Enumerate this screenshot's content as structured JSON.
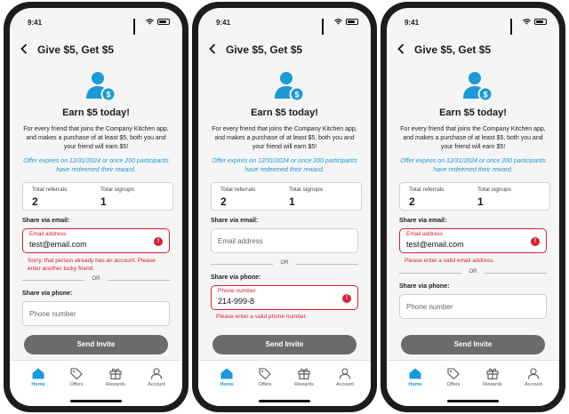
{
  "colors": {
    "accent": "#1a9ad6",
    "error": "#d6202e",
    "button": "#6b6b6b"
  },
  "status_time": "9:41",
  "header": {
    "title": "Give $5, Get $5"
  },
  "earn_title": "Earn $5 today!",
  "description": "For every friend that joins the Company Kitchen app, and makes a purchase of at least $5, both you and your friend will earn $5!",
  "offer_note": "Offer expires on 12/31/2024 or once 200 participants have redeemed their reward.",
  "stats": {
    "referrals_label": "Total referrals",
    "referrals_value": "2",
    "signups_label": "Total signups",
    "signups_value": "1"
  },
  "share_email_label": "Share via email:",
  "share_phone_label": "Share via phone:",
  "or_text": "OR",
  "email_field_label": "Email address",
  "email_placeholder": "Email address",
  "phone_field_label": "Phone number",
  "phone_placeholder": "Phone number",
  "invite_button": "Send Invite",
  "tabs": [
    {
      "label": "Home",
      "icon": "home-icon",
      "active": true
    },
    {
      "label": "Offers",
      "icon": "tag-icon"
    },
    {
      "label": "Rewards",
      "icon": "gift-icon"
    },
    {
      "label": "Account",
      "icon": "person-icon"
    }
  ],
  "screens": [
    {
      "email_value": "test@email.com",
      "email_error": "Sorry, that person already has an account. Please enter another lucky friend."
    },
    {
      "phone_value": "214-999-8",
      "phone_error": "Please enter a valid phone number."
    },
    {
      "email_value": "test@email.com",
      "email_error": "Please enter a valid email address."
    }
  ]
}
